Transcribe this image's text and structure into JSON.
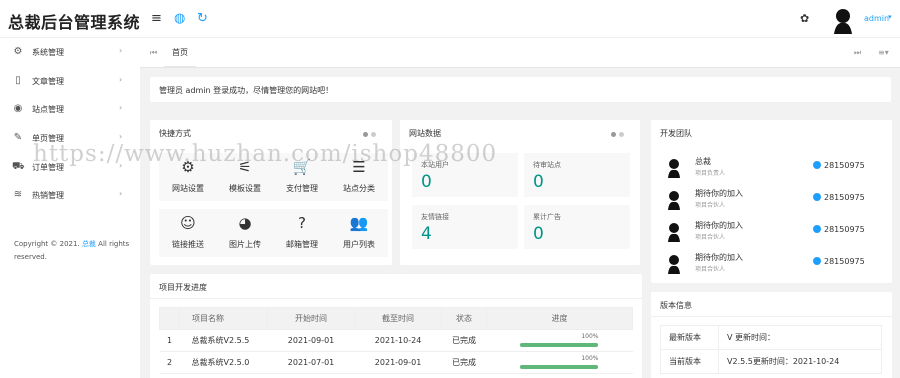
{
  "header": {
    "logo": "总裁后台管理系统",
    "user": "admin",
    "caret": "▾",
    "icons": [
      "menu-icon",
      "globe-icon",
      "refresh-icon",
      "palette-icon",
      "avatar-icon"
    ]
  },
  "sidebar": {
    "items": [
      {
        "label": "系统管理",
        "icon": "gear-icon",
        "glyph": "⚙"
      },
      {
        "label": "文章管理",
        "icon": "file-icon",
        "glyph": "▯"
      },
      {
        "label": "站点管理",
        "icon": "compass-icon",
        "glyph": "◉"
      },
      {
        "label": "单页管理",
        "icon": "edit-file-icon",
        "glyph": "✎"
      },
      {
        "label": "订单管理",
        "icon": "cart-icon",
        "glyph": "⛟"
      },
      {
        "label": "热销管理",
        "icon": "layers-icon",
        "glyph": "≋"
      }
    ],
    "arrow": "›",
    "copyright_prefix": "Copyright © 2021.",
    "copyright_link": "总裁",
    "copyright_suffix": "All rights reserved."
  },
  "tabs": {
    "home_icon": "⏮",
    "home_label": "首页",
    "right_prev": "⏭",
    "right_menu": "≡▾"
  },
  "notice": "管理员 admin 登录成功，尽情管理您的网站吧！",
  "quick": {
    "title": "快捷方式",
    "items": [
      {
        "label": "网站设置",
        "glyph": "⚙",
        "icon": "settings-icon"
      },
      {
        "label": "模板设置",
        "glyph": "⚟",
        "icon": "sliders-icon"
      },
      {
        "label": "支付管理",
        "glyph": "🛒",
        "icon": "cart-icon"
      },
      {
        "label": "站点分类",
        "glyph": "☰",
        "icon": "stack-icon"
      },
      {
        "label": "链接推送",
        "glyph": "☺",
        "icon": "smile-icon"
      },
      {
        "label": "图片上传",
        "glyph": "◕",
        "icon": "compass-icon"
      },
      {
        "label": "邮箱管理",
        "glyph": "?",
        "icon": "help-file-icon"
      },
      {
        "label": "用户列表",
        "glyph": "👥",
        "icon": "users-icon"
      }
    ]
  },
  "stats": {
    "title": "网站数据",
    "items": [
      {
        "label": "本站用户",
        "value": "0"
      },
      {
        "label": "待审站点",
        "value": "0"
      },
      {
        "label": "友情链接",
        "value": "4"
      },
      {
        "label": "累计广告",
        "value": "0"
      }
    ]
  },
  "team": {
    "title": "开发团队",
    "members": [
      {
        "name": "总裁",
        "role": "项目负责人",
        "qq": "28150975"
      },
      {
        "name": "期待你的加入",
        "role": "项目合伙人",
        "qq": "28150975"
      },
      {
        "name": "期待你的加入",
        "role": "项目合伙人",
        "qq": "28150975"
      },
      {
        "name": "期待你的加入",
        "role": "项目合伙人",
        "qq": "28150975"
      }
    ]
  },
  "projects": {
    "title": "项目开发进度",
    "columns": [
      "项目名称",
      "开始时间",
      "截至时间",
      "状态",
      "进度"
    ],
    "rows": [
      {
        "no": "1",
        "name": "总裁系统V2.5.5",
        "start": "2021-09-01",
        "end": "2021-10-24",
        "status": "已完成",
        "progress": "100%",
        "fill": 1.0
      },
      {
        "no": "2",
        "name": "总裁系统V2.5.0",
        "start": "2021-07-01",
        "end": "2021-09-01",
        "status": "已完成",
        "progress": "100%",
        "fill": 1.0
      }
    ]
  },
  "version": {
    "title": "版本信息",
    "rows": [
      {
        "key": "最新版本",
        "value": "V 更新时间："
      },
      {
        "key": "当前版本",
        "value": "V2.5.5更新时间：2021-10-24"
      }
    ]
  },
  "watermark": "https://www.huzhan.com/ishop48800",
  "colors": {
    "accent": "#1e9fff",
    "stat_value": "#009688",
    "done": "#ff5722",
    "done_alt": "#5fb878",
    "progress": "#5fb878"
  }
}
